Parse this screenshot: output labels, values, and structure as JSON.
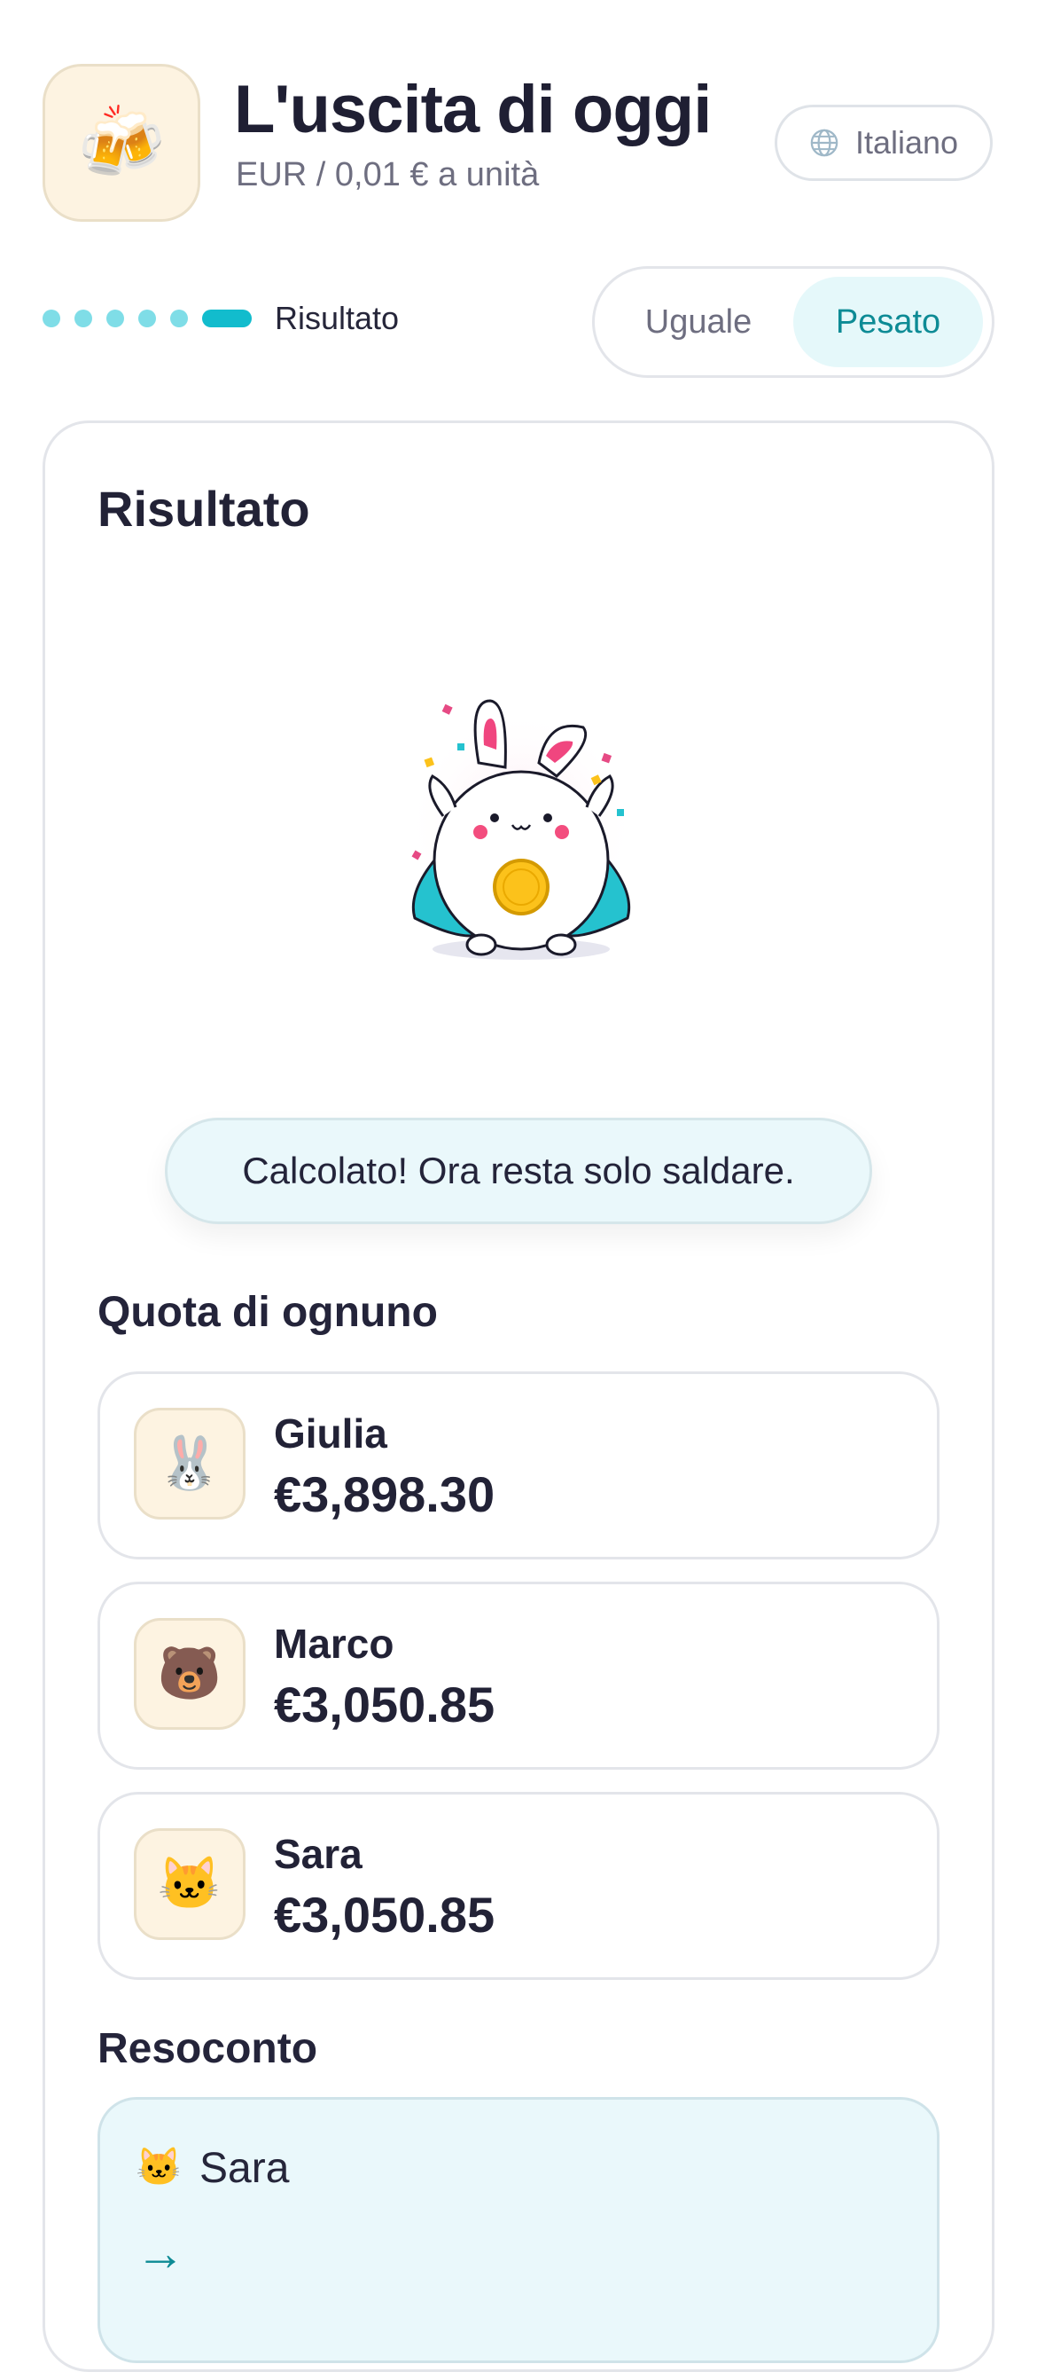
{
  "header": {
    "app_icon": "beer-mugs-icon",
    "app_icon_glyph": "🍻",
    "title": "L'uscita di oggi",
    "subtitle": "EUR / 0,01 € a unità",
    "language_icon": "globe-icon",
    "language_label": "Italiano"
  },
  "progress": {
    "total_steps": 6,
    "current_step": 6,
    "step_label": "Risultato"
  },
  "split_mode": {
    "options": [
      "Uguale",
      "Pesato"
    ],
    "selected": "Pesato"
  },
  "result": {
    "title": "Risultato",
    "mascot": "celebrating-bunny-with-coin",
    "message": "Calcolato! Ora resta solo saldare.",
    "shares_title": "Quota di ognuno",
    "shares": [
      {
        "name": "Giulia",
        "amount": "€3,898.30",
        "avatar": "rabbit-icon",
        "glyph": "🐰"
      },
      {
        "name": "Marco",
        "amount": "€3,050.85",
        "avatar": "bear-icon",
        "glyph": "🐻"
      },
      {
        "name": "Sara",
        "amount": "€3,050.85",
        "avatar": "cat-icon",
        "glyph": "🐱"
      }
    ],
    "summary_title": "Resoconto",
    "summary": {
      "payer_name": "Sara",
      "payer_glyph": "🐱",
      "arrow_icon": "arrow-right-icon",
      "arrow_glyph": "→"
    }
  },
  "colors": {
    "accent": "#12bccd",
    "accent_light": "#7fdde7",
    "selected_text": "#0d8b95",
    "banner_bg": "#eaf8fb"
  }
}
